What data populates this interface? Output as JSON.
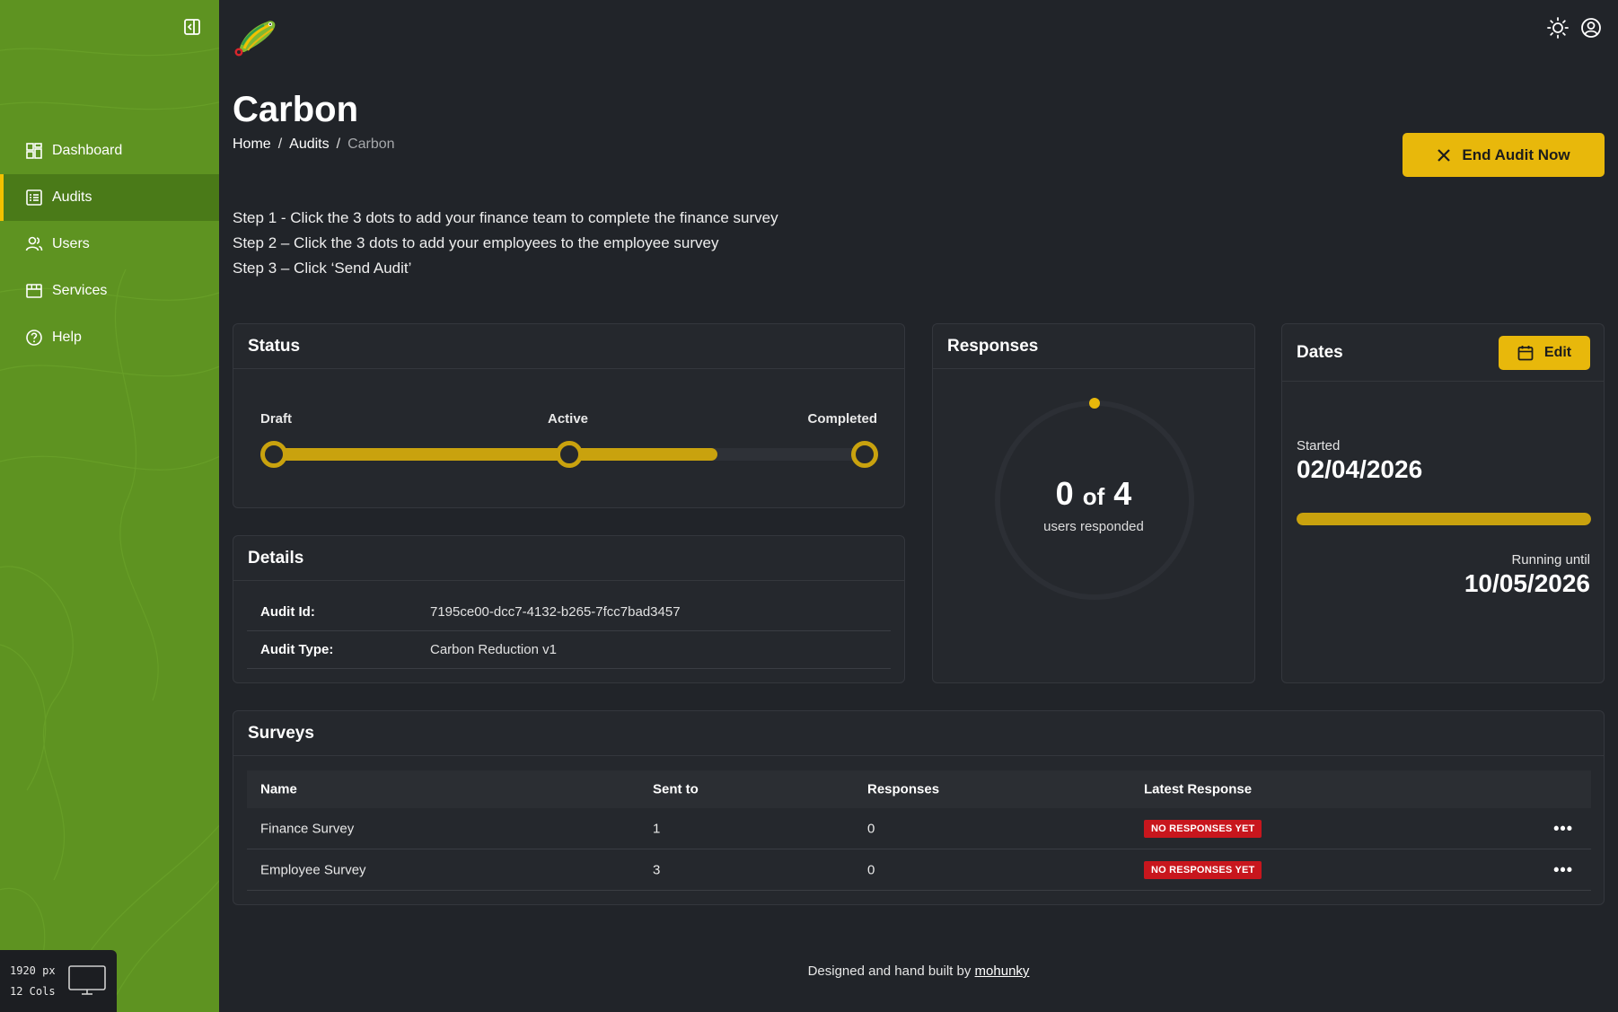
{
  "sidebar": {
    "items": [
      {
        "label": "Dashboard",
        "icon": "dashboard-icon"
      },
      {
        "label": "Audits",
        "icon": "list-icon",
        "active": true
      },
      {
        "label": "Users",
        "icon": "users-icon"
      },
      {
        "label": "Services",
        "icon": "store-icon"
      },
      {
        "label": "Help",
        "icon": "help-icon"
      }
    ],
    "breakpoint": {
      "width": "1920 px",
      "cols": "12 Cols"
    }
  },
  "header": {
    "title": "Carbon",
    "breadcrumb": [
      "Home",
      "Audits",
      "Carbon"
    ],
    "end_button": "End Audit Now"
  },
  "steps": [
    "Step 1 - Click the 3 dots to add your finance team to complete the finance survey",
    "Step 2 – Click the 3 dots to add your employees to the employee survey",
    "Step 3 – Click ‘Send Audit’"
  ],
  "status": {
    "title": "Status",
    "stages": [
      "Draft",
      "Active",
      "Completed"
    ],
    "current_stage": "Active",
    "progress": 0.75
  },
  "details": {
    "title": "Details",
    "rows": [
      {
        "key": "Audit Id:",
        "value": "7195ce00-dcc7-4132-b265-7fcc7bad3457"
      },
      {
        "key": "Audit Type:",
        "value": "Carbon Reduction v1"
      }
    ]
  },
  "responses": {
    "title": "Responses",
    "count": "0",
    "of": "of",
    "total": "4",
    "subtitle": "users responded"
  },
  "dates": {
    "title": "Dates",
    "edit_label": "Edit",
    "started_label": "Started",
    "started_value": "02/04/2026",
    "until_label": "Running until",
    "until_value": "10/05/2026",
    "progress": 1.0
  },
  "surveys": {
    "title": "Surveys",
    "columns": [
      "Name",
      "Sent to",
      "Responses",
      "Latest Response"
    ],
    "rows": [
      {
        "name": "Finance Survey",
        "sent_to": "1",
        "responses": "0",
        "latest": "NO RESPONSES YET"
      },
      {
        "name": "Employee Survey",
        "sent_to": "3",
        "responses": "0",
        "latest": "NO RESPONSES YET"
      }
    ]
  },
  "footer": {
    "text": "Designed and hand built by",
    "link": "mohunky"
  },
  "colors": {
    "sidebar": "#5e9321",
    "accent": "#e8b80b",
    "background": "#212429",
    "badge": "#c8161d"
  }
}
